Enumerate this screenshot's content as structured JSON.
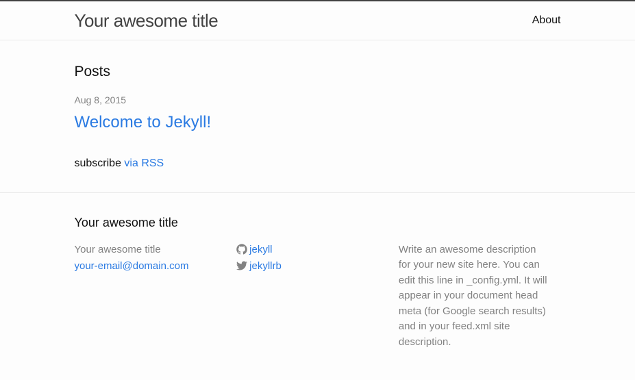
{
  "header": {
    "site_title": "Your awesome title",
    "nav": {
      "about": "About"
    }
  },
  "main": {
    "posts_heading": "Posts",
    "posts": [
      {
        "date": "Aug 8, 2015",
        "title": "Welcome to Jekyll!"
      }
    ],
    "subscribe_text": "subscribe ",
    "subscribe_link": "via RSS"
  },
  "footer": {
    "heading": "Your awesome title",
    "col1": {
      "site_name": "Your awesome title",
      "email": "your-email@domain.com"
    },
    "col2": {
      "github": "jekyll",
      "twitter": "jekyllrb"
    },
    "col3": {
      "description": "Write an awesome description for your new site here. You can edit this line in _config.yml. It will appear in your document head meta (for Google search results) and in your feed.xml site description."
    }
  }
}
